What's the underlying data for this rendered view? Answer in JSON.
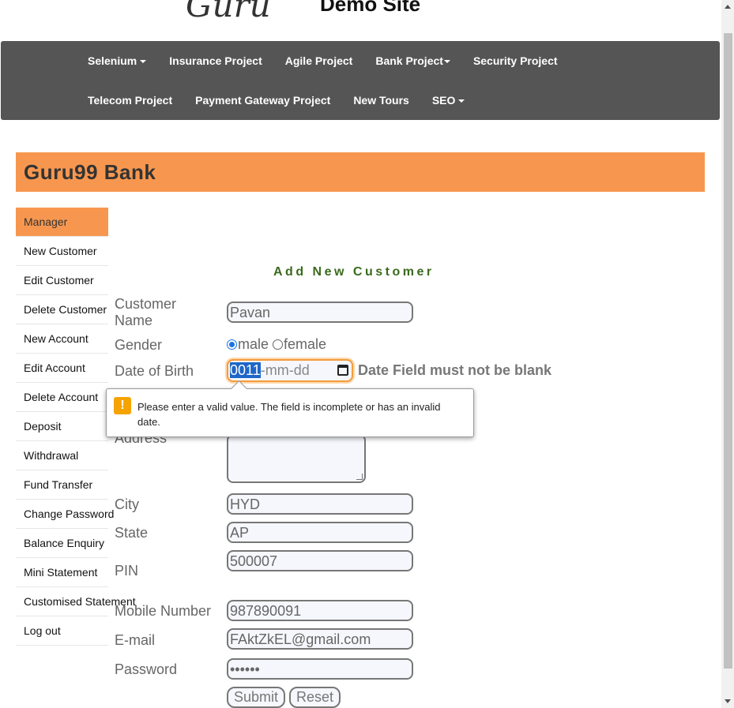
{
  "site": {
    "logo_text": "Guru",
    "title": "Demo Site"
  },
  "nav": {
    "row1": [
      "Selenium",
      "Insurance Project",
      "Agile Project",
      "Bank Project",
      "Security Project"
    ],
    "row2": [
      "Telecom Project",
      "Payment Gateway Project",
      "New Tours",
      "SEO"
    ]
  },
  "bank_title": "Guru99 Bank",
  "sidebar": {
    "items": [
      {
        "label": "Manager"
      },
      {
        "label": "New Customer"
      },
      {
        "label": "Edit Customer"
      },
      {
        "label": "Delete Customer"
      },
      {
        "label": "New Account"
      },
      {
        "label": "Edit Account"
      },
      {
        "label": "Delete Account"
      },
      {
        "label": "Deposit"
      },
      {
        "label": "Withdrawal"
      },
      {
        "label": "Fund Transfer"
      },
      {
        "label": "Change Password"
      },
      {
        "label": "Balance Enquiry"
      },
      {
        "label": "Mini Statement"
      },
      {
        "label": "Customised Statement"
      },
      {
        "label": "Log out"
      }
    ]
  },
  "form": {
    "title": "Add New Customer",
    "labels": {
      "customer_name_1": "Customer",
      "customer_name_2": "Name",
      "gender": "Gender",
      "dob": "Date of Birth",
      "address": "Address",
      "city": "City",
      "state": "State",
      "pin": "PIN",
      "mobile": "Mobile Number",
      "email": "E-mail",
      "password": "Password"
    },
    "values": {
      "customer_name": "Pavan",
      "city": "HYD",
      "state": "AP",
      "pin": "500007",
      "mobile": "987890091",
      "email": "FAktZkEL@gmail.com",
      "password": "••••••"
    },
    "gender_options": {
      "male": "male",
      "female": "female",
      "selected": "male"
    },
    "dob": {
      "year": "0011",
      "rest": "-mm-dd"
    },
    "dob_error": "Date Field must not be blank",
    "tooltip": "Please enter a valid value. The field is incomplete or has an invalid date.",
    "tooltip_icon": "!",
    "buttons": {
      "submit": "Submit",
      "reset": "Reset"
    }
  },
  "colors": {
    "accent": "#f7974f",
    "nav_bg": "#555555",
    "form_title": "#3a6a1d",
    "warning": "#f5a300"
  }
}
